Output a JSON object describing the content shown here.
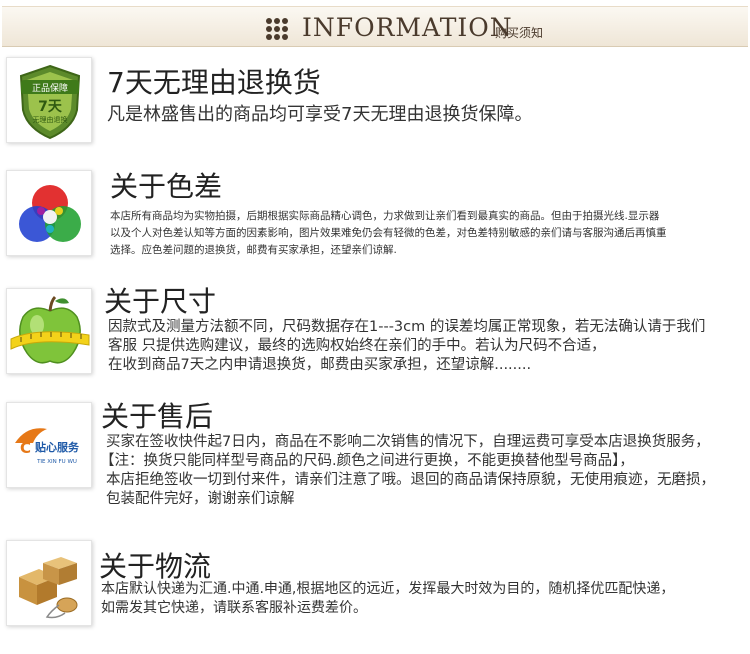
{
  "header": {
    "title": "INFORMATION",
    "subtitle": "购买须知",
    "icon": "dot-grid-icon"
  },
  "sections": [
    {
      "icon": "shield-guarantee-icon",
      "icon_text": [
        "正品保障",
        "7天",
        "无理由退换"
      ],
      "title": "7天无理由退换货",
      "lines": [
        "凡是林盛售出的商品均可享受7天无理由退换货保障。"
      ]
    },
    {
      "icon": "color-wheel-icon",
      "title": "关于色差",
      "lines": [
        "本店所有商品均为实物拍摄，后期根据实际商品精心调色，力求做到让亲们看到最真实的商品。但由于拍摄光线.显示器",
        "以及个人对色差认知等方面的因素影响，图片效果难免仍会有轻微的色差，对色差特别敏感的亲们请与客服沟通后再慎重",
        "选择。应色差问题的退换货，邮费有买家承担，还望亲们谅解."
      ]
    },
    {
      "icon": "apple-tape-measure-icon",
      "title": "关于尺寸",
      "lines": [
        "因款式及测量方法额不同，尺码数据存在1---3cm 的误差均属正常现象，若无法确认请于我们",
        "客服 只提供选购建议，最终的选购权始终在亲们的手中。若认为尺码不合适，",
        "在收到商品7天之内申请退换货，邮费由买家承担，还望谅解........"
      ]
    },
    {
      "icon": "after-sales-service-icon",
      "icon_text": [
        "贴心服务",
        "TIE XIN FU WU"
      ],
      "title": "关于售后",
      "lines": [
        "买家在签收快件起7日内，商品在不影响二次销售的情况下，自理运费可享受本店退换货服务，",
        "【注：换货只能同样型号商品的尺码.颜色之间进行更换，不能更换替他型号商品】，",
        "本店拒绝签收一切到付来件，请亲们注意了哦。退回的商品请保持原貌，无使用痕迹，无磨损，",
        "包装配件完好，谢谢亲们谅解"
      ]
    },
    {
      "icon": "boxes-mouse-icon",
      "title": "关于物流",
      "lines": [
        "本店默认快递为汇通.中通.申通,根据地区的远近，发挥最大时效为目的，随机择优匹配快递，",
        "如需发其它快递，请联系客服补运费差价。"
      ]
    }
  ]
}
